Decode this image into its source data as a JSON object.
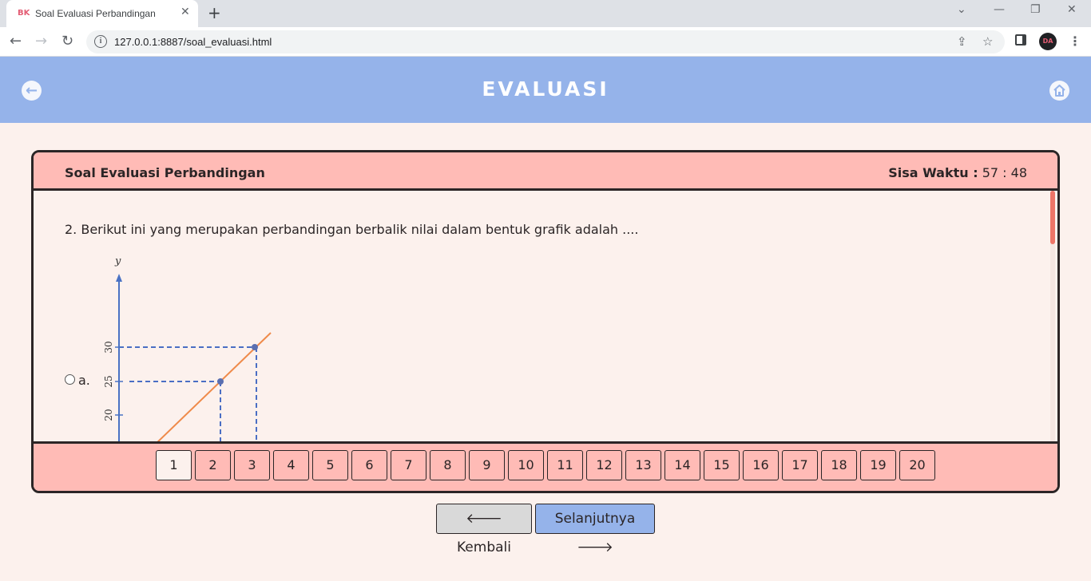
{
  "browser": {
    "tab_title": "Soal Evaluasi Perbandingan",
    "favicon_text": "BK",
    "new_tab": "+",
    "url": "127.0.0.1:8887/soal_evaluasi.html",
    "profile_initials": "DA"
  },
  "header": {
    "title": "EVALUASI"
  },
  "card": {
    "title": "Soal Evaluasi Perbandingan",
    "timer_label": "Sisa Waktu :",
    "timer_value": "57 : 48"
  },
  "question": {
    "text": "2. Berikut ini yang merupakan perbandingan berbalik nilai dalam bentuk grafik adalah ....",
    "option_a_letter": "a.",
    "graph": {
      "y_label": "y",
      "ticks": [
        "20",
        "25",
        "30"
      ]
    }
  },
  "pages": [
    "1",
    "2",
    "3",
    "4",
    "5",
    "6",
    "7",
    "8",
    "9",
    "10",
    "11",
    "12",
    "13",
    "14",
    "15",
    "16",
    "17",
    "18",
    "19",
    "20"
  ],
  "active_page": "1",
  "nav": {
    "back_label": "Kembali",
    "next_label": "Selanjutnya"
  }
}
